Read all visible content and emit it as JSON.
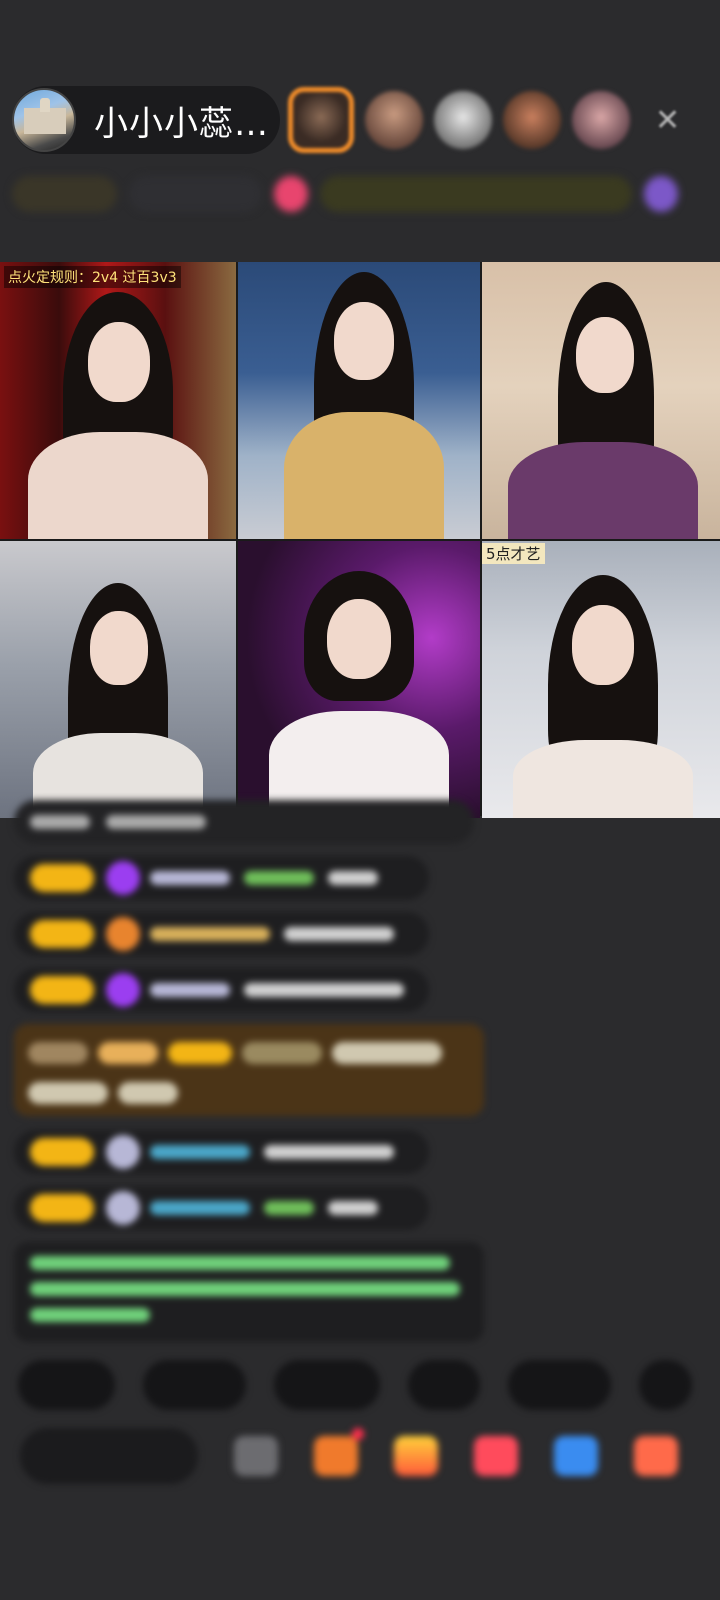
{
  "host": {
    "name": "小小小蕊…",
    "avatar_icon": "castle-photo-avatar"
  },
  "viewers": [
    {
      "icon": "viewer-avatar-top1"
    },
    {
      "icon": "viewer-avatar"
    },
    {
      "icon": "viewer-avatar"
    },
    {
      "icon": "viewer-avatar"
    },
    {
      "icon": "viewer-avatar"
    }
  ],
  "close_icon": "✕",
  "video_grid": {
    "tile1_label": "点火定规则：2v4 过百3v3",
    "tile6_label": "5点才艺"
  },
  "colors": {
    "background": "#2b2b2d",
    "badge_yellow": "#f3b515",
    "top_viewer_border": "#f08c2a",
    "notice_green": "#6fd17a"
  }
}
